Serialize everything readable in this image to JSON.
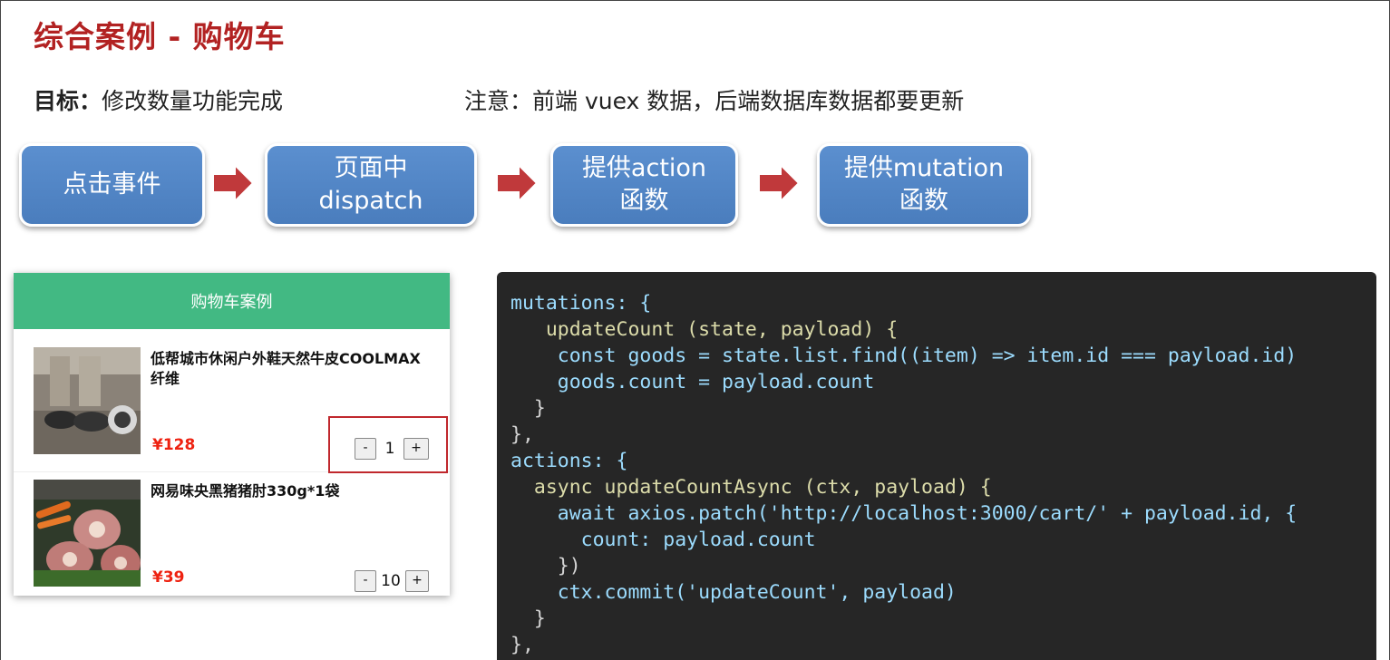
{
  "slide": {
    "title": "综合案例 - 购物车",
    "goal_label": "目标：",
    "goal_text": "修改数量功能完成",
    "note": "注意：前端 vuex 数据，后端数据库数据都要更新"
  },
  "flow": {
    "steps": [
      {
        "line1": "点击事件",
        "line2": ""
      },
      {
        "line1": "页面中",
        "line2": "dispatch"
      },
      {
        "line1": "提供action",
        "line2": "函数"
      },
      {
        "line1": "提供mutation",
        "line2": "函数"
      }
    ]
  },
  "cart": {
    "header": "购物车案例",
    "items": [
      {
        "name": "低帮城市休闲户外鞋天然牛皮COOLMAX纤维",
        "price": "¥128",
        "count": "1",
        "minus": "-",
        "plus": "+"
      },
      {
        "name": "网易味央黑猪猪肘330g*1袋",
        "price": "¥39",
        "count": "10",
        "minus": "-",
        "plus": "+"
      }
    ]
  },
  "code": {
    "lines": [
      "mutations: {",
      "   updateCount (state, payload) {",
      "    const goods = state.list.find((item) => item.id === payload.id)",
      "    goods.count = payload.count",
      "  }",
      "},",
      "actions: {",
      "  async updateCountAsync (ctx, payload) {",
      "    await axios.patch('http://localhost:3000/cart/' + payload.id, {",
      "      count: payload.count",
      "    })",
      "    ctx.commit('updateCount', payload)",
      "  }",
      "},"
    ]
  },
  "colors": {
    "title": "#b22222",
    "flow_box": "#4a7dbd",
    "arrow": "#c0393b",
    "cart_header": "#42b983",
    "price": "#ee2211",
    "code_bg": "#262626",
    "highlight": "#c0282d"
  }
}
